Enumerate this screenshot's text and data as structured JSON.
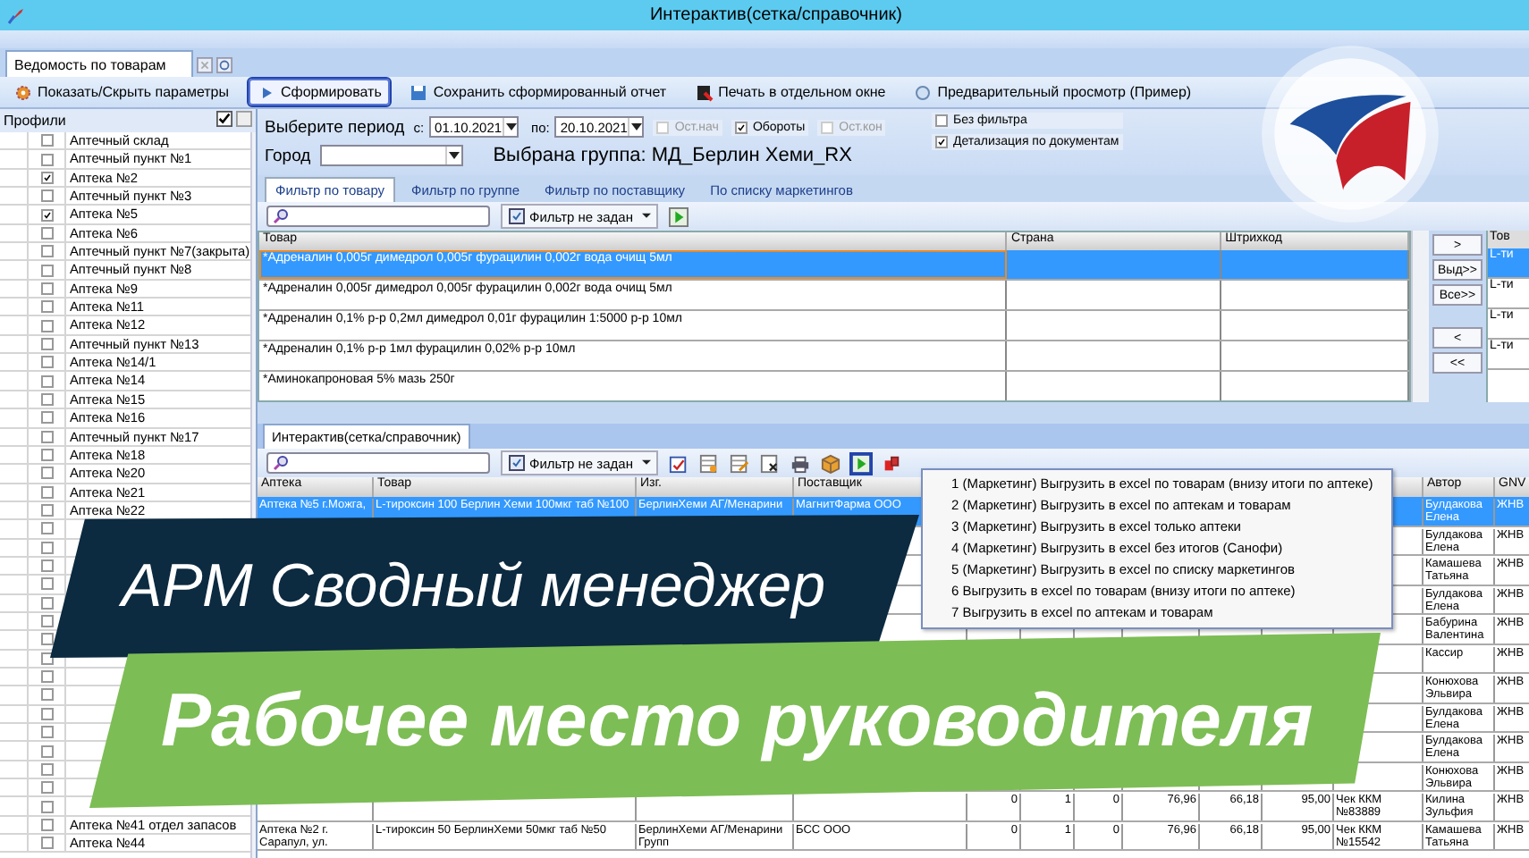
{
  "window": {
    "title": "Интерактив(сетка/справочник)"
  },
  "doc_tabs": [
    {
      "label": "Ведомость по товарам",
      "selected": true
    }
  ],
  "toolbar": [
    {
      "label": "Показать/Скрыть параметры",
      "kind": "gear",
      "focused": false
    },
    {
      "label": "Сформировать",
      "kind": "play",
      "focused": true
    },
    {
      "label": "Сохранить сформированный отчет",
      "kind": "save",
      "focused": false
    },
    {
      "label": "Печать в отдельном окне",
      "kind": "report",
      "focused": false
    },
    {
      "label": "Предварительный просмотр (Пример)",
      "kind": "preview",
      "focused": false
    }
  ],
  "profiles": {
    "title": "Профили",
    "items": [
      {
        "label": "Аптечный склад",
        "checked": false
      },
      {
        "label": "Аптечный пункт №1",
        "checked": false
      },
      {
        "label": "Аптека №2",
        "checked": true
      },
      {
        "label": "Аптечный пункт №3",
        "checked": false
      },
      {
        "label": "Аптека №5",
        "checked": true
      },
      {
        "label": "Аптека №6",
        "checked": false
      },
      {
        "label": "Аптечный пункт №7(закрыта)",
        "checked": false
      },
      {
        "label": "Аптечный пункт №8",
        "checked": false
      },
      {
        "label": "Аптека №9",
        "checked": false
      },
      {
        "label": "Аптека №11",
        "checked": false
      },
      {
        "label": "Аптека №12",
        "checked": false
      },
      {
        "label": "Аптечный пункт №13",
        "checked": false
      },
      {
        "label": "Аптека №14/1",
        "checked": false
      },
      {
        "label": "Аптека №14",
        "checked": false
      },
      {
        "label": "Аптека №15",
        "checked": false
      },
      {
        "label": "Аптека №16",
        "checked": false
      },
      {
        "label": "Аптечный пункт №17",
        "checked": false
      },
      {
        "label": "Аптека №18",
        "checked": false
      },
      {
        "label": "Аптека №20",
        "checked": false
      },
      {
        "label": "Аптека №21",
        "checked": false
      },
      {
        "label": "Аптека №22",
        "checked": false
      },
      {
        "checked": false
      },
      {
        "checked": false
      },
      {
        "checked": false
      },
      {
        "checked": false
      },
      {
        "checked": false
      },
      {
        "checked": false
      },
      {
        "checked": false
      },
      {
        "checked": false
      },
      {
        "checked": false
      },
      {
        "checked": false
      },
      {
        "checked": false
      },
      {
        "checked": false
      },
      {
        "checked": false
      },
      {
        "checked": false
      },
      {
        "checked": false
      },
      {
        "checked": false
      },
      {
        "label": "Аптека №41 отдел запасов",
        "checked": false
      },
      {
        "label": "Аптека №44",
        "checked": false
      }
    ]
  },
  "period": {
    "label": "Выберите период",
    "from_label": "с:",
    "from": "01.10.2021",
    "to_label": "по:",
    "to": "20.10.2021"
  },
  "options": [
    {
      "label": "Ост.нач",
      "checked": false,
      "disabled": true
    },
    {
      "label": "Обороты",
      "checked": true,
      "disabled": false
    },
    {
      "label": "Ост.кон",
      "checked": false,
      "disabled": true
    },
    {
      "label": "Без фильтра",
      "checked": false,
      "disabled": false
    },
    {
      "label": "Детализация по документам",
      "checked": true,
      "disabled": false
    }
  ],
  "city": {
    "label": "Город"
  },
  "group_label": "Выбрана группа: МД_Берлин Хеми_RX",
  "filter_tabs": [
    {
      "label": "Фильтр по товару",
      "selected": true
    },
    {
      "label": "Фильтр по группе",
      "selected": false
    },
    {
      "label": "Фильтр по поставщику",
      "selected": false
    },
    {
      "label": "По списку маркетингов",
      "selected": false
    }
  ],
  "filter_button": "Фильтр не задан",
  "goods_table": {
    "columns": [
      "Товар",
      "Страна",
      "Штрихкод"
    ],
    "rows": [
      {
        "name": "*Адреналин 0,005г димедрол 0,005г фурацилин 0,002г вода очищ 5мл",
        "selected": true
      },
      {
        "name": "*Адреналин 0,005г димедрол 0,005г фурацилин 0,002г вода очищ 5мл",
        "selected": false
      },
      {
        "name": "*Адреналин 0,1% р-р 0,2мл димедрол 0,01г фурацилин 1:5000 р-р 10мл",
        "selected": false
      },
      {
        "name": "*Адреналин 0,1% р-р 1мл фурацилин 0,02% р-р 10мл",
        "selected": false
      },
      {
        "name": "*Аминокапроновая 5% мазь 250г",
        "selected": false
      }
    ]
  },
  "transfer_buttons": [
    ">",
    "Выд>>",
    "Все>>",
    "<",
    "<<"
  ],
  "selected_goods": {
    "column": "Тов",
    "rows": [
      {
        "name": "L-ти",
        "selected": true
      },
      {
        "name": "L-ти",
        "selected": false
      },
      {
        "name": "L-ти",
        "selected": false
      },
      {
        "name": "L-ти",
        "selected": false
      }
    ]
  },
  "bottom_tabs": [
    {
      "label": "Интерактив(сетка/справочник)",
      "selected": true
    }
  ],
  "grid_filter_button": "Фильтр не задан",
  "grid": {
    "columns": [
      {
        "label": "Аптека"
      },
      {
        "label": "Товар"
      },
      {
        "label": "Изг."
      },
      {
        "label": "Поставщик"
      },
      {},
      {},
      {},
      {},
      {},
      {},
      {},
      {
        "label": "Автор"
      },
      {
        "label": "GNV"
      }
    ],
    "rows": [
      {
        "selected": true,
        "cells": {
          "0": "Аптека №5 г.Можга,",
          "1": "L-тироксин 100 Берлин Хеми 100мкг таб №100",
          "2": "БерлинХеми АГ/Менарини",
          "3": "МагнитФарма ООО",
          "11": "Булдакова Елена",
          "12": "ЖНВ"
        }
      },
      {
        "selected": false,
        "cells": {
          "11": "Булдакова Елена",
          "12": "ЖНВ"
        }
      },
      {
        "selected": false,
        "cells": {
          "11": "Камашева Татьяна",
          "12": "ЖНВ"
        }
      },
      {
        "selected": false,
        "cells": {
          "11": "Булдакова Елена",
          "12": "ЖНВ"
        }
      },
      {
        "selected": false,
        "cells": {
          "11": "Бабурина Валентина",
          "12": "ЖНВ"
        }
      },
      {
        "selected": false,
        "cells": {
          "11": "Кассир",
          "12": "ЖНВ"
        }
      },
      {
        "selected": false,
        "cells": {
          "11": "Конюхова Эльвира",
          "12": "ЖНВ"
        }
      },
      {
        "selected": false,
        "cells": {
          "11": "Булдакова Елена",
          "12": "ЖНВ"
        }
      },
      {
        "selected": false,
        "cells": {
          "11": "Булдакова Елена",
          "12": "ЖНВ"
        }
      },
      {
        "selected": false,
        "cells": {
          "11": "Конюхова Эльвира",
          "12": "ЖНВ"
        }
      },
      {
        "selected": false,
        "cells": {
          "4": "0",
          "5": "1",
          "6": "0",
          "7": "76,96",
          "8": "66,18",
          "9": "95,00",
          "10": "Чек ККМ №83889",
          "11": "Килина Зульфия",
          "12": "ЖНВ"
        }
      },
      {
        "selected": false,
        "cells": {
          "0": "Аптека №2 г. Сарапул, ул.",
          "1": "L-тироксин 50 БерлинХеми 50мкг таб №50",
          "2": "БерлинХеми АГ/Менарини Групп",
          "3": "БСС ООО",
          "4": "0",
          "5": "1",
          "6": "0",
          "7": "76,96",
          "8": "66,18",
          "9": "95,00",
          "10": "Чек ККМ №15542",
          "11": "Камашева Татьяна",
          "12": "ЖНВ"
        }
      }
    ]
  },
  "export_menu": {
    "items": [
      "1 (Маркетинг) Выгрузить в excel по товарам (внизу итоги по аптеке)",
      "2 (Маркетинг) Выгрузить в excel по аптекам и товарам",
      "3 (Маркетинг) Выгрузить в excel только аптеки",
      "4 (Маркетинг) Выгрузить в excel без итогов (Санофи)",
      "5 (Маркетинг) Выгрузить в excel по списку маркетингов",
      "6 Выгрузить в excel по товарам (внизу итоги по аптеке)",
      "7 Выгрузить в excel по аптекам и товарам"
    ]
  },
  "banners": [
    {
      "text": "АРМ Сводный менеджер",
      "kind": "dark"
    },
    {
      "text": "Рабочее место руководителя",
      "kind": "green"
    }
  ]
}
